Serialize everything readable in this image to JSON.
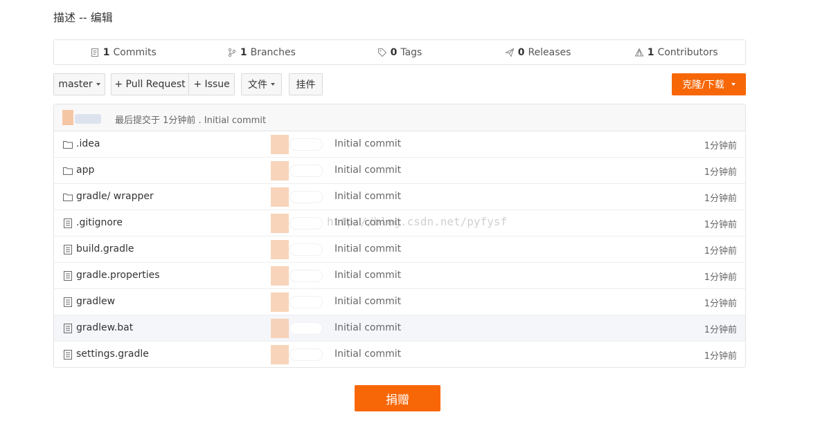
{
  "page": {
    "description": "描述 -- 编辑"
  },
  "stats": [
    {
      "count": "1",
      "label": "Commits",
      "icon": "commits-icon"
    },
    {
      "count": "1",
      "label": "Branches",
      "icon": "branch-icon"
    },
    {
      "count": "0",
      "label": "Tags",
      "icon": "tag-icon"
    },
    {
      "count": "0",
      "label": "Releases",
      "icon": "release-icon"
    },
    {
      "count": "1",
      "label": "Contributors",
      "icon": "contributors-icon"
    }
  ],
  "toolbar": {
    "branch": "master",
    "pull_request": "+ Pull Request",
    "issue": "+ Issue",
    "file": "文件",
    "widget": "挂件",
    "clone": "克隆/下载"
  },
  "last_commit": {
    "text": "最后提交于 1分钟前 . Initial commit"
  },
  "files": [
    {
      "name": ".idea",
      "type": "folder",
      "message": "Initial commit",
      "time": "1分钟前"
    },
    {
      "name": "app",
      "type": "folder",
      "message": "Initial commit",
      "time": "1分钟前"
    },
    {
      "name": "gradle/ wrapper",
      "type": "folder",
      "message": "Initial commit",
      "time": "1分钟前"
    },
    {
      "name": ".gitignore",
      "type": "file",
      "message": "Initial commit",
      "time": "1分钟前"
    },
    {
      "name": "build.gradle",
      "type": "file",
      "message": "Initial commit",
      "time": "1分钟前"
    },
    {
      "name": "gradle.properties",
      "type": "file",
      "message": "Initial commit",
      "time": "1分钟前"
    },
    {
      "name": "gradlew",
      "type": "file",
      "message": "Initial commit",
      "time": "1分钟前"
    },
    {
      "name": "gradlew.bat",
      "type": "file",
      "message": "Initial commit",
      "time": "1分钟前"
    },
    {
      "name": "settings.gradle",
      "type": "file",
      "message": "Initial commit",
      "time": "1分钟前"
    }
  ],
  "watermark": "http://blog.csdn.net/pyfysf",
  "donate": "捐赠",
  "colors": {
    "accent": "#f76707"
  }
}
